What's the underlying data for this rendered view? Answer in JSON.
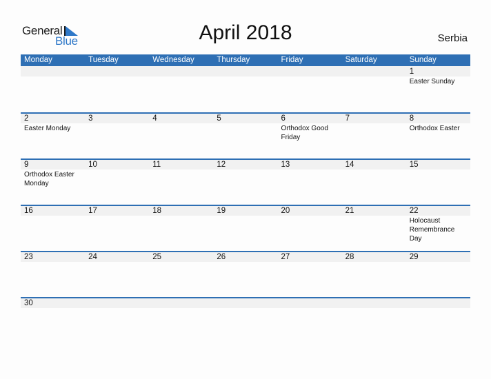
{
  "logo": {
    "word1": "General",
    "word2": "Blue"
  },
  "title": "April 2018",
  "country": "Serbia",
  "colors": {
    "header": "#2E6FB4",
    "strip": "#f1f1f1",
    "logo_blue": "#2E78C8"
  },
  "weekdays": [
    "Monday",
    "Tuesday",
    "Wednesday",
    "Thursday",
    "Friday",
    "Saturday",
    "Sunday"
  ],
  "weeks": [
    [
      {
        "d": "",
        "e": ""
      },
      {
        "d": "",
        "e": ""
      },
      {
        "d": "",
        "e": ""
      },
      {
        "d": "",
        "e": ""
      },
      {
        "d": "",
        "e": ""
      },
      {
        "d": "",
        "e": ""
      },
      {
        "d": "1",
        "e": "Easter Sunday"
      }
    ],
    [
      {
        "d": "2",
        "e": "Easter Monday"
      },
      {
        "d": "3",
        "e": ""
      },
      {
        "d": "4",
        "e": ""
      },
      {
        "d": "5",
        "e": ""
      },
      {
        "d": "6",
        "e": "Orthodox Good Friday"
      },
      {
        "d": "7",
        "e": ""
      },
      {
        "d": "8",
        "e": "Orthodox Easter"
      }
    ],
    [
      {
        "d": "9",
        "e": "Orthodox Easter Monday"
      },
      {
        "d": "10",
        "e": ""
      },
      {
        "d": "11",
        "e": ""
      },
      {
        "d": "12",
        "e": ""
      },
      {
        "d": "13",
        "e": ""
      },
      {
        "d": "14",
        "e": ""
      },
      {
        "d": "15",
        "e": ""
      }
    ],
    [
      {
        "d": "16",
        "e": ""
      },
      {
        "d": "17",
        "e": ""
      },
      {
        "d": "18",
        "e": ""
      },
      {
        "d": "19",
        "e": ""
      },
      {
        "d": "20",
        "e": ""
      },
      {
        "d": "21",
        "e": ""
      },
      {
        "d": "22",
        "e": "Holocaust Remembrance Day"
      }
    ],
    [
      {
        "d": "23",
        "e": ""
      },
      {
        "d": "24",
        "e": ""
      },
      {
        "d": "25",
        "e": ""
      },
      {
        "d": "26",
        "e": ""
      },
      {
        "d": "27",
        "e": ""
      },
      {
        "d": "28",
        "e": ""
      },
      {
        "d": "29",
        "e": ""
      }
    ],
    [
      {
        "d": "30",
        "e": ""
      },
      {
        "d": "",
        "e": ""
      },
      {
        "d": "",
        "e": ""
      },
      {
        "d": "",
        "e": ""
      },
      {
        "d": "",
        "e": ""
      },
      {
        "d": "",
        "e": ""
      },
      {
        "d": "",
        "e": ""
      }
    ]
  ]
}
